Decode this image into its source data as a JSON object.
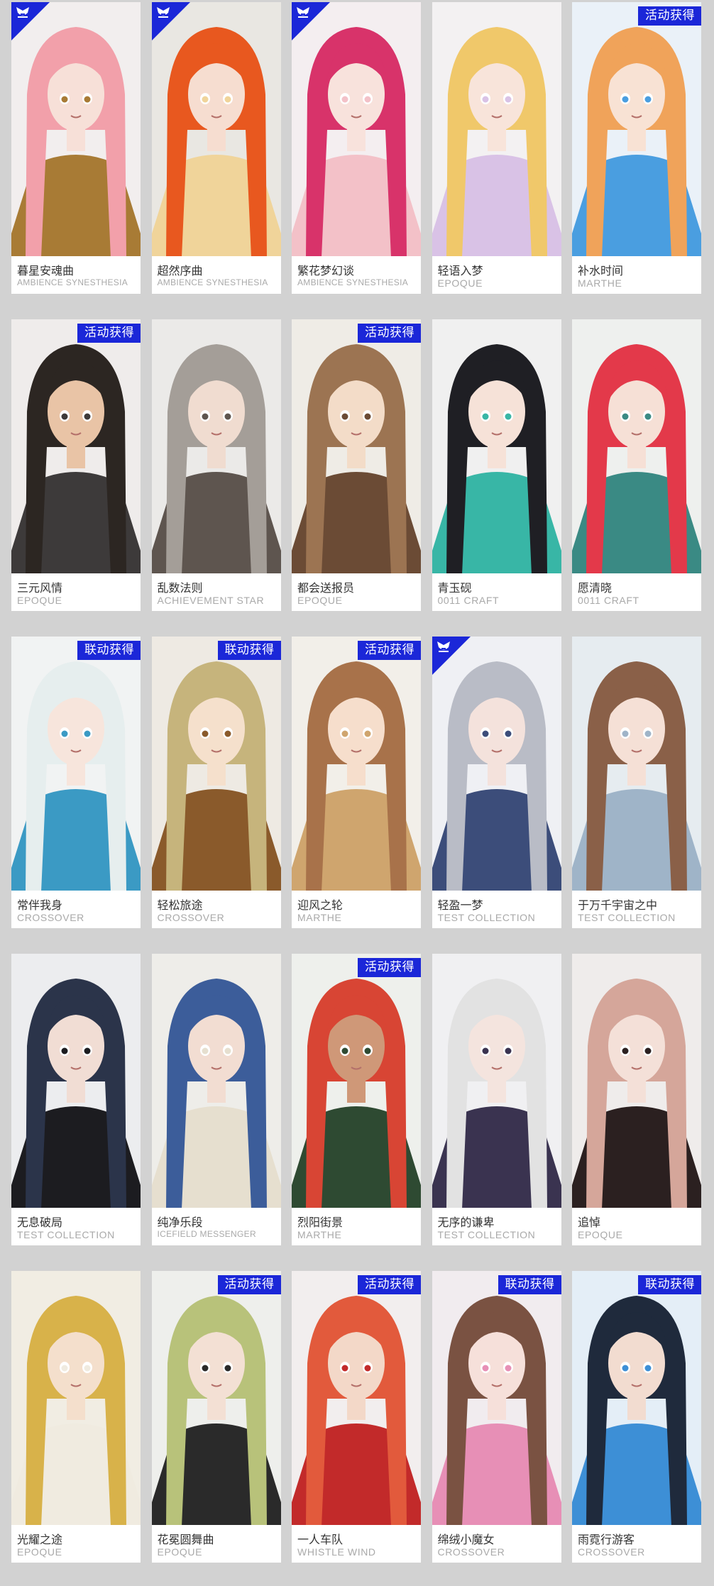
{
  "gallery": {
    "rows": [
      [
        {
          "name": "暮星安魂曲",
          "series": "AMBIENCE SYNESTHESIA",
          "badge": "",
          "corner": true,
          "palette": {
            "bg": "#f2eeee",
            "hair": "#f2a0aa",
            "accent": "#a87b35",
            "skin": "#f7e0d8"
          }
        },
        {
          "name": "超然序曲",
          "series": "AMBIENCE SYNESTHESIA",
          "badge": "",
          "corner": true,
          "palette": {
            "bg": "#e9e7e2",
            "hair": "#e8581f",
            "accent": "#f0d49a",
            "skin": "#f6ddd0"
          }
        },
        {
          "name": "繁花梦幻谈",
          "series": "AMBIENCE SYNESTHESIA",
          "badge": "",
          "corner": true,
          "palette": {
            "bg": "#f4eef0",
            "hair": "#d8336a",
            "accent": "#f3c1c8",
            "skin": "#f8e2dc"
          }
        },
        {
          "name": "轻语入梦",
          "series": "EPOQUE",
          "badge": "",
          "corner": false,
          "palette": {
            "bg": "#f3f1f2",
            "hair": "#f0c86a",
            "accent": "#d9c2e6",
            "skin": "#f8e4da"
          }
        },
        {
          "name": "补水时间",
          "series": "MARTHE",
          "badge": "活动获得",
          "corner": false,
          "palette": {
            "bg": "#eaf1f8",
            "hair": "#f0a35a",
            "accent": "#4a9ee0",
            "skin": "#f8e2d4"
          }
        }
      ],
      [
        {
          "name": "三元风情",
          "series": "EPOQUE",
          "badge": "活动获得",
          "corner": false,
          "palette": {
            "bg": "#efeceb",
            "hair": "#2c2622",
            "accent": "#3d3a3a",
            "skin": "#e9c4a6"
          }
        },
        {
          "name": "乱数法则",
          "series": "ACHIEVEMENT STAR",
          "badge": "",
          "corner": false,
          "palette": {
            "bg": "#ebeae8",
            "hair": "#a49e98",
            "accent": "#5e554f",
            "skin": "#f0dcd0"
          }
        },
        {
          "name": "都会送报员",
          "series": "EPOQUE",
          "badge": "活动获得",
          "corner": false,
          "palette": {
            "bg": "#efece6",
            "hair": "#9c7452",
            "accent": "#6b4b35",
            "skin": "#f3dcc8"
          }
        },
        {
          "name": "青玉砚",
          "series": "0011 CRAFT",
          "badge": "",
          "corner": false,
          "palette": {
            "bg": "#f0f0f0",
            "hair": "#1f1f24",
            "accent": "#38b6a6",
            "skin": "#f6e2d8"
          }
        },
        {
          "name": "愿清晓",
          "series": "0011 CRAFT",
          "badge": "",
          "corner": false,
          "palette": {
            "bg": "#eef0ee",
            "hair": "#e3394a",
            "accent": "#3a8a84",
            "skin": "#f6e0d6"
          }
        }
      ],
      [
        {
          "name": "常伴我身",
          "series": "CROSSOVER",
          "badge": "联动获得",
          "corner": false,
          "palette": {
            "bg": "#f1f3f3",
            "hair": "#e6eeee",
            "accent": "#3b9ac4",
            "skin": "#f7e5dc"
          }
        },
        {
          "name": "轻松旅途",
          "series": "CROSSOVER",
          "badge": "联动获得",
          "corner": false,
          "palette": {
            "bg": "#eeeae3",
            "hair": "#c6b47c",
            "accent": "#8a5a2b",
            "skin": "#f5e0cc"
          }
        },
        {
          "name": "迎风之轮",
          "series": "MARTHE",
          "badge": "活动获得",
          "corner": false,
          "palette": {
            "bg": "#f2efe9",
            "hair": "#a8724a",
            "accent": "#cfa56e",
            "skin": "#f6decc"
          }
        },
        {
          "name": "轻盈一梦",
          "series": "TEST COLLECTION",
          "badge": "",
          "corner": true,
          "palette": {
            "bg": "#eff0f4",
            "hair": "#b9bcc6",
            "accent": "#3c4d7a",
            "skin": "#f4e2dc"
          }
        },
        {
          "name": "于万千宇宙之中",
          "series": "TEST COLLECTION",
          "badge": "",
          "corner": false,
          "palette": {
            "bg": "#e6ecf0",
            "hair": "#8a6048",
            "accent": "#9fb4c8",
            "skin": "#f5e0d6"
          }
        }
      ],
      [
        {
          "name": "无息破局",
          "series": "TEST COLLECTION",
          "badge": "",
          "corner": false,
          "palette": {
            "bg": "#ecedef",
            "hair": "#2b344a",
            "accent": "#1c1c20",
            "skin": "#f1ddd4"
          }
        },
        {
          "name": "纯净乐段",
          "series": "ICEFIELD MESSENGER",
          "badge": "",
          "corner": false,
          "palette": {
            "bg": "#eeede9",
            "hair": "#3c5d9a",
            "accent": "#e6dfcf",
            "skin": "#f2ddd2"
          }
        },
        {
          "name": "烈阳街景",
          "series": "MARTHE",
          "badge": "活动获得",
          "corner": false,
          "palette": {
            "bg": "#eef0ec",
            "hair": "#d84534",
            "accent": "#2e4a32",
            "skin": "#cf9878"
          }
        },
        {
          "name": "无序的谦卑",
          "series": "TEST COLLECTION",
          "badge": "",
          "corner": false,
          "palette": {
            "bg": "#f0f0f2",
            "hair": "#e2e2e2",
            "accent": "#3a3350",
            "skin": "#f4e4de"
          }
        },
        {
          "name": "追悼",
          "series": "EPOQUE",
          "badge": "",
          "corner": false,
          "palette": {
            "bg": "#efeceb",
            "hair": "#d5a69a",
            "accent": "#2b2020",
            "skin": "#f4e0d8"
          }
        }
      ],
      [
        {
          "name": "光耀之途",
          "series": "EPOQUE",
          "badge": "",
          "corner": false,
          "palette": {
            "bg": "#f1ede3",
            "hair": "#d8b24a",
            "accent": "#f0ebe0",
            "skin": "#f4dfcc"
          }
        },
        {
          "name": "花冕圆舞曲",
          "series": "EPOQUE",
          "badge": "活动获得",
          "corner": false,
          "palette": {
            "bg": "#eeefec",
            "hair": "#b8c27a",
            "accent": "#2a2a2a",
            "skin": "#f3e0d4"
          }
        },
        {
          "name": "一人车队",
          "series": "WHISTLE WIND",
          "badge": "活动获得",
          "corner": false,
          "palette": {
            "bg": "#f2eeee",
            "hair": "#e25a3c",
            "accent": "#c22a2a",
            "skin": "#f3d8c8"
          }
        },
        {
          "name": "绵绒小魔女",
          "series": "CROSSOVER",
          "badge": "联动获得",
          "corner": false,
          "palette": {
            "bg": "#f1ecef",
            "hair": "#7a5242",
            "accent": "#e78fb6",
            "skin": "#f6e0da"
          }
        },
        {
          "name": "雨霓行游客",
          "series": "CROSSOVER",
          "badge": "联动获得",
          "corner": false,
          "palette": {
            "bg": "#e4eef7",
            "hair": "#1f2a3c",
            "accent": "#3d8fd6",
            "skin": "#f2dcd0"
          }
        }
      ]
    ]
  }
}
